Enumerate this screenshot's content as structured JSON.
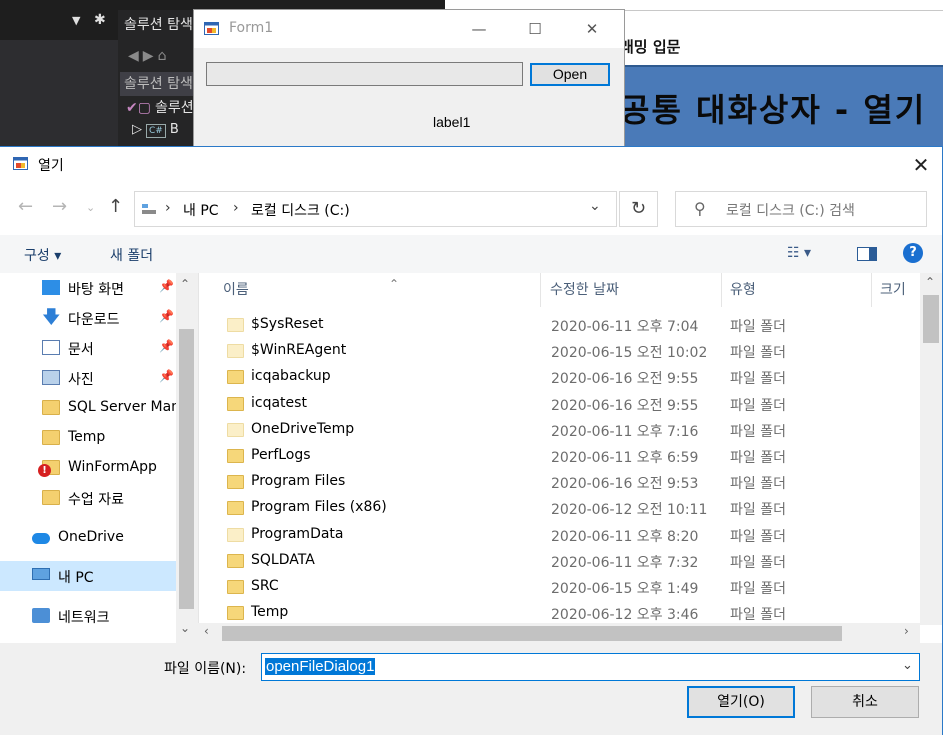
{
  "vs": {
    "solution_explorer_title": "솔루션 탐색기",
    "search_placeholder": "솔루션 탐색기 검색",
    "solution_item": "솔루션",
    "project_item": "B"
  },
  "doc": {
    "heading": "래밍 입문",
    "banner": "공통 대화상자 - 열기"
  },
  "form1": {
    "title": "Form1",
    "open_button": "Open",
    "label": "label1"
  },
  "dialog": {
    "title": "열기",
    "address": {
      "segments": [
        "내 PC",
        "로컬 디스크 (C:)"
      ]
    },
    "search_placeholder": "로컬 디스크 (C:) 검색",
    "commands": {
      "organize": "구성 ▾",
      "new_folder": "새 폴더"
    },
    "nav_items": [
      {
        "label": "바탕 화면",
        "icon": "desktop-icon",
        "pinned": true
      },
      {
        "label": "다운로드",
        "icon": "download-icon",
        "pinned": true
      },
      {
        "label": "문서",
        "icon": "documents-icon",
        "pinned": true
      },
      {
        "label": "사진",
        "icon": "pictures-icon",
        "pinned": true
      },
      {
        "label": "SQL Server Man",
        "icon": "folder-icon",
        "pinned": false
      },
      {
        "label": "Temp",
        "icon": "folder-icon",
        "pinned": false
      },
      {
        "label": "WinFormApp",
        "icon": "folder-error-icon",
        "pinned": false
      },
      {
        "label": "수업 자료",
        "icon": "folder-icon",
        "pinned": false
      },
      {
        "label": "OneDrive",
        "icon": "onedrive-icon",
        "pinned": false
      },
      {
        "label": "내 PC",
        "icon": "this-pc-icon",
        "pinned": false,
        "selected": true
      },
      {
        "label": "네트워크",
        "icon": "network-icon",
        "pinned": false
      }
    ],
    "columns": [
      "이름",
      "수정한 날짜",
      "유형",
      "크기"
    ],
    "files": [
      {
        "name": "$SysReset",
        "date": "2020-06-11 오후 7:04",
        "type": "파일 폴더",
        "faint": true
      },
      {
        "name": "$WinREAgent",
        "date": "2020-06-15 오전 10:02",
        "type": "파일 폴더",
        "faint": true
      },
      {
        "name": "icqabackup",
        "date": "2020-06-16 오전 9:55",
        "type": "파일 폴더",
        "faint": false
      },
      {
        "name": "icqatest",
        "date": "2020-06-16 오전 9:55",
        "type": "파일 폴더",
        "faint": false
      },
      {
        "name": "OneDriveTemp",
        "date": "2020-06-11 오후 7:16",
        "type": "파일 폴더",
        "faint": true
      },
      {
        "name": "PerfLogs",
        "date": "2020-06-11 오후 6:59",
        "type": "파일 폴더",
        "faint": false
      },
      {
        "name": "Program Files",
        "date": "2020-06-16 오전 9:53",
        "type": "파일 폴더",
        "faint": false
      },
      {
        "name": "Program Files (x86)",
        "date": "2020-06-12 오전 10:11",
        "type": "파일 폴더",
        "faint": false
      },
      {
        "name": "ProgramData",
        "date": "2020-06-11 오후 8:20",
        "type": "파일 폴더",
        "faint": true
      },
      {
        "name": "SQLDATA",
        "date": "2020-06-11 오후 7:32",
        "type": "파일 폴더",
        "faint": false
      },
      {
        "name": "SRC",
        "date": "2020-06-15 오후 1:49",
        "type": "파일 폴더",
        "faint": false
      },
      {
        "name": "Temp",
        "date": "2020-06-12 오후 3:46",
        "type": "파일 폴더",
        "faint": false
      }
    ],
    "filename_label": "파일 이름(N):",
    "filename_value": "openFileDialog1",
    "open_button": "열기(O)",
    "cancel_button": "취소"
  }
}
